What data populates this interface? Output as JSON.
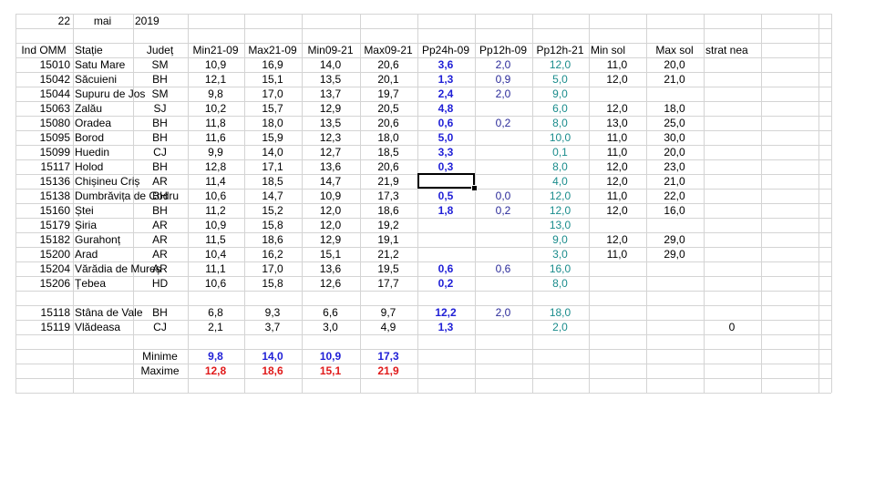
{
  "date": {
    "day": "22",
    "month": "mai",
    "year": "2019"
  },
  "headers": [
    "Ind OMM",
    "Stație",
    "Județ",
    "Min21-09",
    "Max21-09",
    "Min09-21",
    "Max09-21",
    "Pp24h-09",
    "Pp12h-09",
    "Pp12h-21",
    "Min sol",
    "Max sol",
    "strat nea"
  ],
  "rows": [
    {
      "ind": "15010",
      "station": "Satu Mare",
      "county": "SM",
      "min2109": "10,9",
      "max2109": "16,9",
      "min0921": "14,0",
      "max0921": "20,6",
      "pp24": "3,6",
      "pp1209": "2,0",
      "pp1221": "12,0",
      "minsol": "11,0",
      "maxsol": "20,0",
      "snow": ""
    },
    {
      "ind": "15042",
      "station": "Săcuieni",
      "county": "BH",
      "min2109": "12,1",
      "max2109": "15,1",
      "min0921": "13,5",
      "max0921": "20,1",
      "pp24": "1,3",
      "pp1209": "0,9",
      "pp1221": "5,0",
      "minsol": "12,0",
      "maxsol": "21,0",
      "snow": ""
    },
    {
      "ind": "15044",
      "station": "Supuru de Jos",
      "county": "SM",
      "min2109": "9,8",
      "max2109": "17,0",
      "min0921": "13,7",
      "max0921": "19,7",
      "pp24": "2,4",
      "pp1209": "2,0",
      "pp1221": "9,0",
      "minsol": "",
      "maxsol": "",
      "snow": ""
    },
    {
      "ind": "15063",
      "station": "Zalău",
      "county": "SJ",
      "min2109": "10,2",
      "max2109": "15,7",
      "min0921": "12,9",
      "max0921": "20,5",
      "pp24": "4,8",
      "pp1209": "",
      "pp1221": "6,0",
      "minsol": "12,0",
      "maxsol": "18,0",
      "snow": ""
    },
    {
      "ind": "15080",
      "station": "Oradea",
      "county": "BH",
      "min2109": "11,8",
      "max2109": "18,0",
      "min0921": "13,5",
      "max0921": "20,6",
      "pp24": "0,6",
      "pp1209": "0,2",
      "pp1221": "8,0",
      "minsol": "13,0",
      "maxsol": "25,0",
      "snow": ""
    },
    {
      "ind": "15095",
      "station": "Borod",
      "county": "BH",
      "min2109": "11,6",
      "max2109": "15,9",
      "min0921": "12,3",
      "max0921": "18,0",
      "pp24": "5,0",
      "pp1209": "",
      "pp1221": "10,0",
      "minsol": "11,0",
      "maxsol": "30,0",
      "snow": ""
    },
    {
      "ind": "15099",
      "station": "Huedin",
      "county": "CJ",
      "min2109": "9,9",
      "max2109": "14,0",
      "min0921": "12,7",
      "max0921": "18,5",
      "pp24": "3,3",
      "pp1209": "",
      "pp1221": "0,1",
      "minsol": "11,0",
      "maxsol": "20,0",
      "snow": ""
    },
    {
      "ind": "15117",
      "station": "Holod",
      "county": "BH",
      "min2109": "12,8",
      "max2109": "17,1",
      "min0921": "13,6",
      "max0921": "20,6",
      "pp24": "0,3",
      "pp1209": "",
      "pp1221": "8,0",
      "minsol": "12,0",
      "maxsol": "23,0",
      "snow": ""
    },
    {
      "ind": "15136",
      "station": "Chișineu   Criș",
      "county": "AR",
      "min2109": "11,4",
      "max2109": "18,5",
      "min0921": "14,7",
      "max0921": "21,9",
      "pp24": "",
      "pp1209": "",
      "pp1221": "4,0",
      "minsol": "12,0",
      "maxsol": "21,0",
      "snow": ""
    },
    {
      "ind": "15138",
      "station": "Dumbrăvița de Codru",
      "county": "BH",
      "min2109": "10,6",
      "max2109": "14,7",
      "min0921": "10,9",
      "max0921": "17,3",
      "pp24": "0,5",
      "pp1209": "0,0",
      "pp1221": "12,0",
      "minsol": "11,0",
      "maxsol": "22,0",
      "snow": ""
    },
    {
      "ind": "15160",
      "station": "Ștei",
      "county": "BH",
      "min2109": "11,2",
      "max2109": "15,2",
      "min0921": "12,0",
      "max0921": "18,6",
      "pp24": "1,8",
      "pp1209": "0,2",
      "pp1221": "12,0",
      "minsol": "12,0",
      "maxsol": "16,0",
      "snow": ""
    },
    {
      "ind": "15179",
      "station": "Șiria",
      "county": "AR",
      "min2109": "10,9",
      "max2109": "15,8",
      "min0921": "12,0",
      "max0921": "19,2",
      "pp24": "",
      "pp1209": "",
      "pp1221": "13,0",
      "minsol": "",
      "maxsol": "",
      "snow": ""
    },
    {
      "ind": "15182",
      "station": "Gurahonț",
      "county": "AR",
      "min2109": "11,5",
      "max2109": "18,6",
      "min0921": "12,9",
      "max0921": "19,1",
      "pp24": "",
      "pp1209": "",
      "pp1221": "9,0",
      "minsol": "12,0",
      "maxsol": "29,0",
      "snow": ""
    },
    {
      "ind": "15200",
      "station": "Arad",
      "county": "AR",
      "min2109": "10,4",
      "max2109": "16,2",
      "min0921": "15,1",
      "max0921": "21,2",
      "pp24": "",
      "pp1209": "",
      "pp1221": "3,0",
      "minsol": "11,0",
      "maxsol": "29,0",
      "snow": ""
    },
    {
      "ind": "15204",
      "station": "Vărădia de Mureș",
      "county": "AR",
      "min2109": "11,1",
      "max2109": "17,0",
      "min0921": "13,6",
      "max0921": "19,5",
      "pp24": "0,6",
      "pp1209": "0,6",
      "pp1221": "16,0",
      "minsol": "",
      "maxsol": "",
      "snow": ""
    },
    {
      "ind": "15206",
      "station": "Țebea",
      "county": "HD",
      "min2109": "10,6",
      "max2109": "15,8",
      "min0921": "12,6",
      "max0921": "17,7",
      "pp24": "0,2",
      "pp1209": "",
      "pp1221": "8,0",
      "minsol": "",
      "maxsol": "",
      "snow": ""
    },
    {
      "ind": "",
      "station": "",
      "county": "",
      "min2109": "",
      "max2109": "",
      "min0921": "",
      "max0921": "",
      "pp24": "",
      "pp1209": "",
      "pp1221": "",
      "minsol": "",
      "maxsol": "",
      "snow": ""
    },
    {
      "ind": "15118",
      "station": "Stâna de Vale",
      "county": "BH",
      "min2109": "6,8",
      "max2109": "9,3",
      "min0921": "6,6",
      "max0921": "9,7",
      "pp24": "12,2",
      "pp1209": "2,0",
      "pp1221": "18,0",
      "minsol": "",
      "maxsol": "",
      "snow": ""
    },
    {
      "ind": "15119",
      "station": "Vlădeasa",
      "county": "CJ",
      "min2109": "2,1",
      "max2109": "3,7",
      "min0921": "3,0",
      "max0921": "4,9",
      "pp24": "1,3",
      "pp1209": "",
      "pp1221": "2,0",
      "minsol": "",
      "maxsol": "",
      "snow": "0"
    }
  ],
  "summary": {
    "min_label": "Minime",
    "max_label": "Maxime",
    "min_values": [
      "9,8",
      "14,0",
      "10,9",
      "17,3"
    ],
    "max_values": [
      "12,8",
      "18,6",
      "15,1",
      "21,9"
    ]
  },
  "colors": {
    "grid": "#d4d4d4",
    "pp24": "#1f1fd6",
    "pp12": "#2b2b9a",
    "pp21": "#1a8c8c",
    "max": "#e01a1a"
  }
}
